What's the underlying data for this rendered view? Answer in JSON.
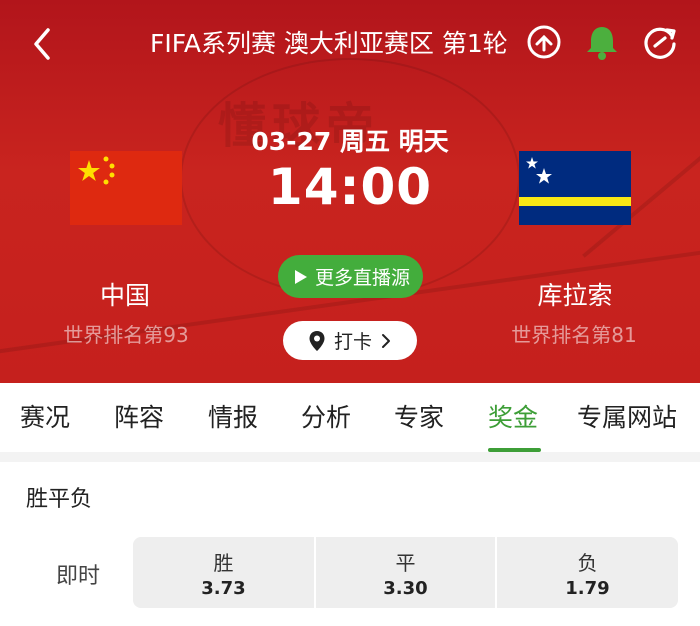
{
  "header": {
    "title": "FIFA系列赛 澳大利亚赛区 第1轮",
    "icons": [
      "back-icon",
      "share-icon",
      "bell-icon",
      "refresh-icon"
    ],
    "watermark": "懂球帝"
  },
  "match": {
    "date_line": "03-27 周五 明天",
    "time": "14:00",
    "home": {
      "name": "中国",
      "rank": "世界排名第93",
      "flag": "china-flag"
    },
    "away": {
      "name": "库拉索",
      "rank": "世界排名第81",
      "flag": "curacao-flag"
    },
    "live_button": "更多直播源",
    "checkin_button": "打卡"
  },
  "tabs": [
    {
      "label": "赛况"
    },
    {
      "label": "阵容"
    },
    {
      "label": "情报"
    },
    {
      "label": "分析"
    },
    {
      "label": "专家"
    },
    {
      "label": "奖金",
      "active": true
    },
    {
      "label": "专属网站"
    }
  ],
  "odds_section": {
    "title": "胜平负",
    "row_label": "即时",
    "cells": [
      {
        "label": "胜",
        "value": "3.73"
      },
      {
        "label": "平",
        "value": "3.30"
      },
      {
        "label": "负",
        "value": "1.79"
      }
    ]
  },
  "colors": {
    "hero_red": "#c5201d",
    "accent_green": "#3d9e37",
    "live_green": "#43ad3c"
  }
}
